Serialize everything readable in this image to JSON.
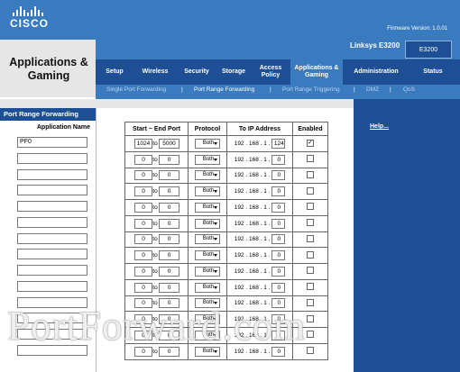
{
  "header": {
    "brand": "CISCO",
    "firmware": "Firmware Version: 1.0.01",
    "model_name": "Linksys E3200",
    "model_code": "E3200"
  },
  "section_title": "Applications & Gaming",
  "tabs": [
    {
      "label": "Setup"
    },
    {
      "label": "Wireless"
    },
    {
      "label": "Security"
    },
    {
      "label": "Storage"
    },
    {
      "label": "Access Policy"
    },
    {
      "label": "Applications & Gaming"
    },
    {
      "label": "Administration"
    },
    {
      "label": "Status"
    }
  ],
  "subtabs": [
    {
      "label": "Single Port Forwarding"
    },
    {
      "label": "Port Range Forwarding"
    },
    {
      "label": "Port Range Triggering"
    },
    {
      "label": "DMZ"
    },
    {
      "label": "QoS"
    }
  ],
  "left_panel": {
    "title": "Port Range Forwarding",
    "column_label": "Application Name"
  },
  "table": {
    "headers": [
      "Start ~ End Port",
      "Protocol",
      "To IP Address",
      "Enabled"
    ],
    "ip_prefix": "192 . 168 . 1 .",
    "to_label": "to",
    "rows": [
      {
        "name": "PF0",
        "start": "1024",
        "end": "5000",
        "protocol": "Both",
        "ip_last": "124",
        "enabled": "✓"
      },
      {
        "name": "",
        "start": "0",
        "end": "0",
        "protocol": "Both",
        "ip_last": "0",
        "enabled": ""
      },
      {
        "name": "",
        "start": "0",
        "end": "0",
        "protocol": "Both",
        "ip_last": "0",
        "enabled": ""
      },
      {
        "name": "",
        "start": "0",
        "end": "0",
        "protocol": "Both",
        "ip_last": "0",
        "enabled": ""
      },
      {
        "name": "",
        "start": "0",
        "end": "0",
        "protocol": "Both",
        "ip_last": "0",
        "enabled": ""
      },
      {
        "name": "",
        "start": "0",
        "end": "0",
        "protocol": "Both",
        "ip_last": "0",
        "enabled": ""
      },
      {
        "name": "",
        "start": "0",
        "end": "0",
        "protocol": "Both",
        "ip_last": "0",
        "enabled": ""
      },
      {
        "name": "",
        "start": "0",
        "end": "0",
        "protocol": "Both",
        "ip_last": "0",
        "enabled": ""
      },
      {
        "name": "",
        "start": "0",
        "end": "0",
        "protocol": "Both",
        "ip_last": "0",
        "enabled": ""
      },
      {
        "name": "",
        "start": "0",
        "end": "0",
        "protocol": "Both",
        "ip_last": "0",
        "enabled": ""
      },
      {
        "name": "",
        "start": "0",
        "end": "0",
        "protocol": "Both",
        "ip_last": "0",
        "enabled": ""
      },
      {
        "name": "",
        "start": "0",
        "end": "0",
        "protocol": "Both",
        "ip_last": "0",
        "enabled": ""
      },
      {
        "name": "",
        "start": "0",
        "end": "0",
        "protocol": "Both",
        "ip_last": "0",
        "enabled": ""
      },
      {
        "name": "",
        "start": "0",
        "end": "0",
        "protocol": "Both",
        "ip_last": "0",
        "enabled": ""
      }
    ]
  },
  "help_link": "Help...",
  "watermark": "PortForward.com"
}
